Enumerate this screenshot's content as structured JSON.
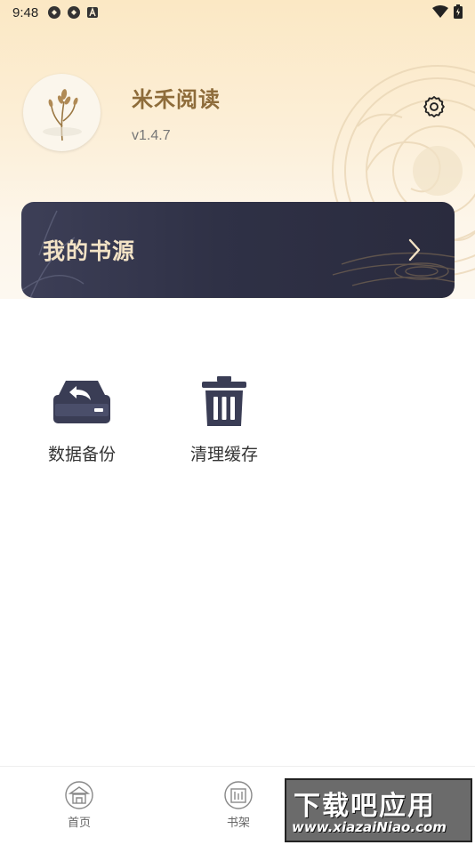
{
  "status_bar": {
    "time": "9:48"
  },
  "profile": {
    "app_name": "米禾阅读",
    "version": "v1.4.7"
  },
  "source_card": {
    "label": "我的书源"
  },
  "tools": [
    {
      "label": "数据备份",
      "icon": "backup-drive-icon"
    },
    {
      "label": "清理缓存",
      "icon": "trash-icon"
    }
  ],
  "nav": [
    {
      "label": "首页",
      "icon": "home-icon"
    },
    {
      "label": "书架",
      "icon": "bookshelf-icon"
    }
  ],
  "watermark": {
    "title": "下载吧应用",
    "url": "www.xiazaiNiao.com"
  },
  "colors": {
    "accent": "#8e6c3a",
    "card_bg": "#2f3146",
    "card_text": "#f3e3c6"
  }
}
